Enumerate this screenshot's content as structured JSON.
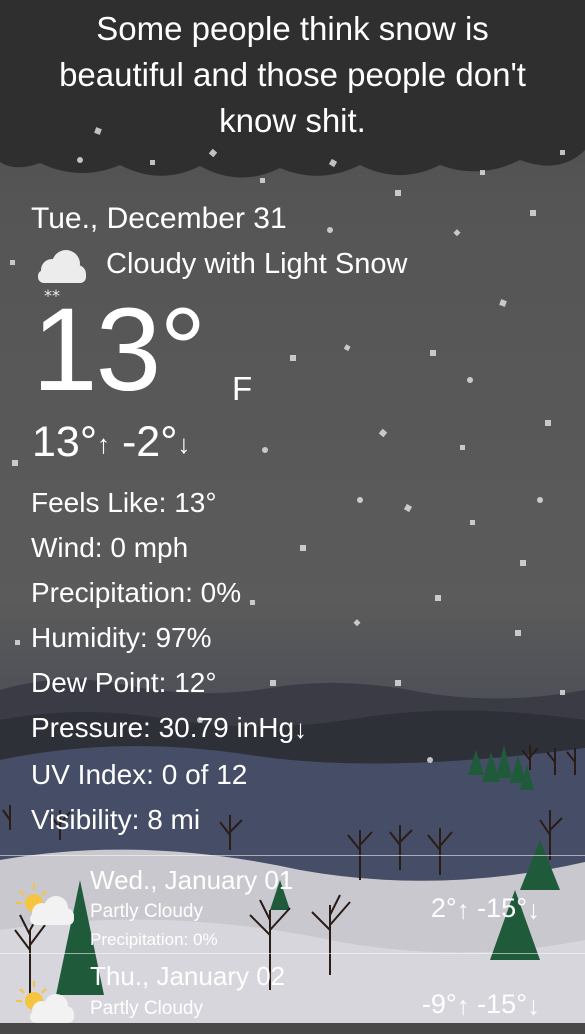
{
  "headline": "Some people think snow is beautiful and those people don't know shit.",
  "current": {
    "date": "Tue., December 31",
    "icon": "cloud-snow-icon",
    "condition": "Cloudy with Light Snow",
    "temperature": "13°",
    "unit": "F",
    "high": "13°",
    "high_arrow": "↑",
    "low": "-2°",
    "low_arrow": "↓"
  },
  "details": [
    {
      "label": "Feels Like:",
      "value": "13°"
    },
    {
      "label": "Wind:",
      "value": "0 mph"
    },
    {
      "label": "Precipitation:",
      "value": "0%"
    },
    {
      "label": "Humidity:",
      "value": "97%"
    },
    {
      "label": "Dew Point:",
      "value": "12°"
    },
    {
      "label": "Pressure:",
      "value": "30.79 inHg",
      "trend": "↓"
    },
    {
      "label": "UV Index:",
      "value": "0 of 12"
    },
    {
      "label": "Visibility:",
      "value": "8 mi"
    }
  ],
  "forecast": [
    {
      "day": "Wed., January 01",
      "icon": "partly-cloudy-icon",
      "condition": "Partly Cloudy",
      "precipitation": "Precipitation: 0%",
      "high": "2°",
      "high_arrow": "↑",
      "low": "-15°",
      "low_arrow": "↓"
    },
    {
      "day": "Thu., January 02",
      "icon": "partly-cloudy-icon",
      "condition": "Partly Cloudy",
      "high": "-9°",
      "high_arrow": "↑",
      "low": "-15°",
      "low_arrow": "↓"
    }
  ],
  "colors": {
    "sky_top": "#3a3a3a",
    "sky": "#5b5b5b",
    "mountains": "#35363d",
    "hill_dark": "#424a5e",
    "snow_ground": "#c9c9cf",
    "tree_green": "#1f5a3a",
    "sun": "#f5c542"
  }
}
